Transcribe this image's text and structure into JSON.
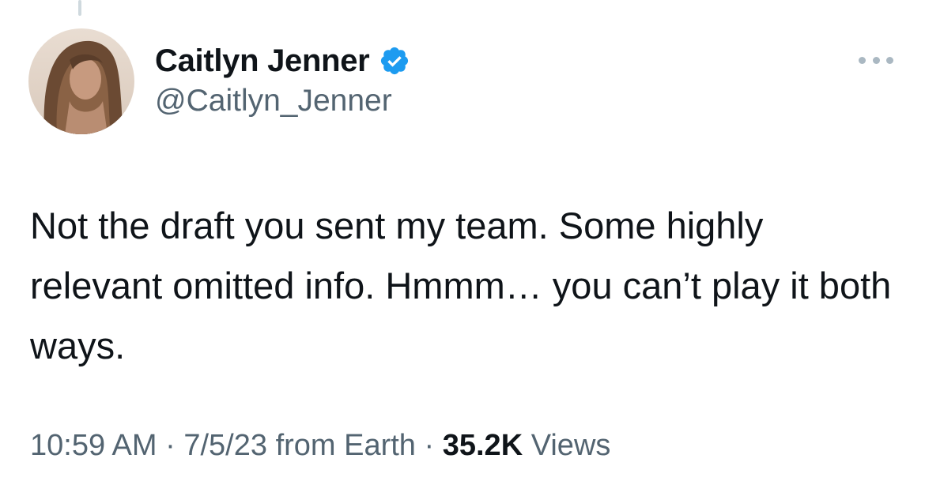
{
  "tweet": {
    "author": {
      "display_name": "Caitlyn Jenner",
      "handle": "@Caitlyn_Jenner",
      "verified": true,
      "verified_icon": "verified-badge-icon",
      "verified_color": "#1d9bf0"
    },
    "body": "Not the draft you sent my team. Some highly relevant omitted info. Hmmm… you can’t play it both ways.",
    "meta": {
      "time": "10:59 AM",
      "separator": " · ",
      "date": "7/5/23",
      "source": "from Earth",
      "views_count": "35.2K",
      "views_label": "Views"
    },
    "more_icon": "more-options-icon"
  },
  "colors": {
    "text_primary": "#0f1419",
    "text_secondary": "#536471",
    "thread_line": "#cfd9de",
    "more_dots": "#aab8c2"
  }
}
